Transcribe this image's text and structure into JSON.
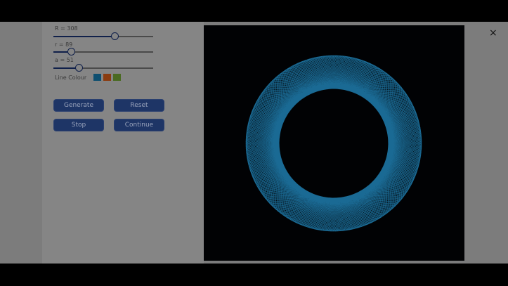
{
  "controls": {
    "R": {
      "label": "R = 308",
      "value": 308,
      "min": 0,
      "max": 500
    },
    "r": {
      "label": "r = 89",
      "value": 89,
      "min": 0,
      "max": 500
    },
    "a": {
      "label": "a = 51",
      "value": 51,
      "min": 0,
      "max": 200
    },
    "line_colour_label": "Line Colour",
    "swatches": [
      "#0e4f70",
      "#8a3c10",
      "#4a6a22"
    ],
    "line_colour": "#1a6a94"
  },
  "buttons": {
    "generate": "Generate",
    "reset": "Reset",
    "stop": "Stop",
    "continue": "Continue"
  },
  "close_icon": "×"
}
